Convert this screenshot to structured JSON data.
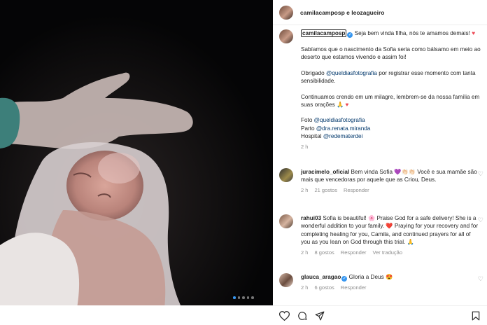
{
  "header": {
    "names": "camilacamposp e leozagueiro"
  },
  "caption": {
    "username": "camilacamposp",
    "first_line": " Seja bem vinda filha, nós te amamos demais! ",
    "p1": "Sabíamos que o nascimento da Sofia seria como bálsamo em meio ao deserto que estamos vivendo e assim foi!",
    "p2a": "Obrigado ",
    "p2_mention": "@queldiasfotografia",
    "p2b": " por registrar esse momento com tanta sensibilidade.",
    "p3": "Continuamos crendo em um milagre, lembrem-se da nossa família em suas orações 🙏",
    "foto_label": "Foto ",
    "foto_mention": "@queldiasfotografia",
    "parto_label": "Parto ",
    "parto_mention": "@dra.renata.miranda",
    "hospital_label": "Hospital ",
    "hospital_mention": "@redematerdei",
    "time": "2 h"
  },
  "comments": [
    {
      "username": "juracimelo_oficial",
      "text": " Bem vinda Sofia 💜👏🏻👏🏻 Você e sua mamãe são mais que vencedoras por aquele que as Criou, Deus.",
      "time": "2 h",
      "likes": "21 gostos",
      "reply": "Responder"
    },
    {
      "username": "rahui03",
      "text": " Sofia is beautiful! 🌸 Praise God for a safe delivery! She is a wonderful addition to your family. ❤️ Praying for your recovery and for completing healing for you, Camila, and continued prayers for all of you as you lean on God through this trial. 🙏",
      "time": "2 h",
      "likes": "8 gostos",
      "reply": "Responder",
      "translate": "Ver tradução"
    },
    {
      "username": "glauca_aragao",
      "text": " Gloria a Deus 😍",
      "time": "2 h",
      "likes": "6 gostos",
      "reply": "Responder"
    }
  ],
  "icons": [
    "like-icon",
    "comment-icon",
    "share-icon",
    "save-icon",
    "verified-icon"
  ],
  "colors": {
    "link": "#00376b",
    "verified": "#3897f0",
    "heart": "#ed4956",
    "meta": "#8e8e8e"
  },
  "carousel": {
    "count": 5,
    "active": 1
  }
}
